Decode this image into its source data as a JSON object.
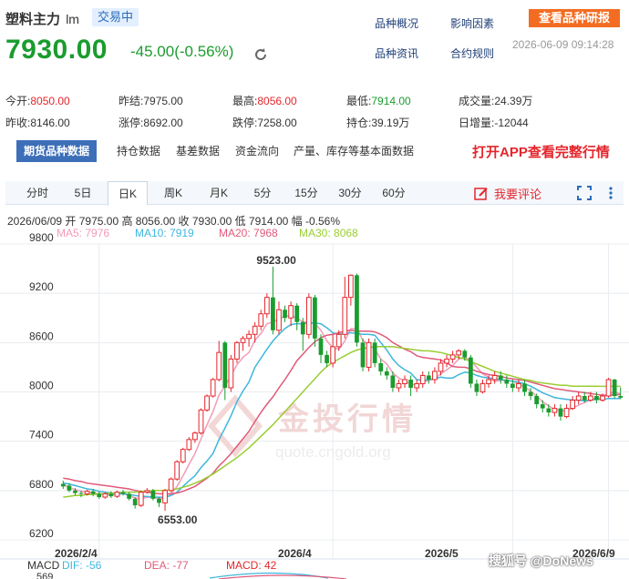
{
  "header": {
    "title": "塑料主力",
    "title_suffix": "lm",
    "badge": "交易中",
    "price": "7930.00",
    "change": "-45.00(-0.56%)",
    "datetime": "2026-06-09 09:14:28",
    "links": [
      "品种概况",
      "影响因素",
      "品种资讯",
      "合约规则"
    ],
    "research_button": "查看品种研报"
  },
  "stats": [
    {
      "label": "今开:",
      "value": "8050.00",
      "tone": "red"
    },
    {
      "label": "昨结:",
      "value": "7975.00",
      "tone": "plain"
    },
    {
      "label": "最高:",
      "value": "8056.00",
      "tone": "red"
    },
    {
      "label": "最低:",
      "value": "7914.00",
      "tone": "green"
    },
    {
      "label": "成交量:",
      "value": "24.39万",
      "tone": "plain"
    },
    {
      "label": "昨收:",
      "value": "8146.00",
      "tone": "plain"
    },
    {
      "label": "涨停:",
      "value": "8692.00",
      "tone": "plain"
    },
    {
      "label": "跌停:",
      "value": "7258.00",
      "tone": "plain"
    },
    {
      "label": "持仓:",
      "value": "39.19万",
      "tone": "plain"
    },
    {
      "label": "日增量:",
      "value": "-12044",
      "tone": "plain"
    }
  ],
  "data_tabs": [
    "期货品种数据",
    "持仓数据",
    "基差数据",
    "资金流向",
    "产量、库存等基本面数据"
  ],
  "app_promo": "打开APP查看完整行情",
  "period_tabs": [
    "分时",
    "5日",
    "日K",
    "周K",
    "月K",
    "5分",
    "15分",
    "30分",
    "60分"
  ],
  "active_period": "日K",
  "comment_button": "我要评论",
  "kline_info": {
    "date": "2026/06/09",
    "open": "开 7975.00",
    "high": "高 8056.00",
    "close": "收 7930.00",
    "low": "低 7914.00",
    "amp": "幅 -0.56%"
  },
  "ma_labels": [
    {
      "text": "MA5: 7976",
      "color": "#f39bb8"
    },
    {
      "text": "MA10: 7919",
      "color": "#3fb6dd"
    },
    {
      "text": "MA20: 7968",
      "color": "#e05a7a"
    },
    {
      "text": "MA30: 8068",
      "color": "#9acd32"
    }
  ],
  "macd": {
    "label": "MACD",
    "dif": "DIF: -56",
    "dea": "DEA: -77",
    "macd": "MACD: 42",
    "axis_top": "569"
  },
  "watermark": {
    "main": "金投行情",
    "sub": "quote.cngold.org"
  },
  "corner_watermark": "搜狐号 @DoNews",
  "colors": {
    "up": "#e4262c",
    "down": "#1a9c2e",
    "brand": "#3d6fb8"
  },
  "chart_data": {
    "type": "candlestick",
    "y_ticks": [
      9800,
      9200,
      8600,
      8000,
      7400,
      6800,
      6200
    ],
    "ylim": [
      6200,
      9800
    ],
    "x_ticks": [
      "2026/2/4",
      "2026/4",
      "2026/5",
      "2026/6/9"
    ],
    "annotations": [
      {
        "text": "9523.00",
        "value": 9523
      },
      {
        "text": "6553.00",
        "value": 6553
      }
    ],
    "candles": [
      [
        6880,
        6850,
        6920,
        6820
      ],
      [
        6860,
        6800,
        6890,
        6780
      ],
      [
        6800,
        6770,
        6830,
        6740
      ],
      [
        6770,
        6760,
        6800,
        6720
      ],
      [
        6760,
        6790,
        6810,
        6740
      ],
      [
        6790,
        6760,
        6820,
        6730
      ],
      [
        6760,
        6720,
        6790,
        6700
      ],
      [
        6720,
        6760,
        6780,
        6700
      ],
      [
        6760,
        6730,
        6790,
        6710
      ],
      [
        6730,
        6780,
        6800,
        6710
      ],
      [
        6780,
        6760,
        6810,
        6740
      ],
      [
        6760,
        6700,
        6780,
        6680
      ],
      [
        6700,
        6620,
        6720,
        6580
      ],
      [
        6620,
        6780,
        6800,
        6600
      ],
      [
        6780,
        6800,
        6830,
        6760
      ],
      [
        6800,
        6700,
        6820,
        6680
      ],
      [
        6700,
        6650,
        6720,
        6600
      ],
      [
        6650,
        6800,
        6820,
        6553
      ],
      [
        6800,
        6940,
        6960,
        6780
      ],
      [
        6940,
        7150,
        7170,
        6920
      ],
      [
        7150,
        7300,
        7320,
        7130
      ],
      [
        7300,
        7420,
        7450,
        7280
      ],
      [
        7420,
        7500,
        7520,
        7380
      ],
      [
        7500,
        7780,
        7800,
        7480
      ],
      [
        7780,
        7950,
        7970,
        7760
      ],
      [
        7950,
        8150,
        8170,
        7930
      ],
      [
        8150,
        8480,
        8620,
        8130
      ],
      [
        8600,
        8050,
        8620,
        7900
      ],
      [
        8050,
        8400,
        8450,
        8000
      ],
      [
        8400,
        8600,
        8620,
        8350
      ],
      [
        8600,
        8650,
        8680,
        8500
      ],
      [
        8650,
        8700,
        8750,
        8550
      ],
      [
        8700,
        8800,
        8850,
        8600
      ],
      [
        8800,
        8950,
        9000,
        8750
      ],
      [
        8950,
        9150,
        9200,
        8900
      ],
      [
        9150,
        8750,
        9523,
        8700
      ],
      [
        8750,
        9000,
        9100,
        8700
      ],
      [
        9000,
        8900,
        9050,
        8850
      ],
      [
        8900,
        9050,
        9100,
        8800
      ],
      [
        9050,
        8850,
        9080,
        8750
      ],
      [
        8850,
        8700,
        8900,
        8500
      ],
      [
        8700,
        9150,
        9200,
        8650
      ],
      [
        9150,
        8650,
        9180,
        8550
      ],
      [
        8650,
        8450,
        8700,
        8350
      ],
      [
        8450,
        8350,
        8500,
        8300
      ],
      [
        8350,
        8550,
        8700,
        8300
      ],
      [
        8550,
        8700,
        8750,
        8500
      ],
      [
        8700,
        9150,
        9400,
        8650
      ],
      [
        9150,
        9420,
        9430,
        9050
      ],
      [
        9420,
        8600,
        9440,
        8550
      ],
      [
        8600,
        8300,
        8650,
        8250
      ],
      [
        8300,
        8600,
        8650,
        8250
      ],
      [
        8600,
        8350,
        8650,
        8300
      ],
      [
        8350,
        8250,
        8400,
        8200
      ],
      [
        8250,
        8200,
        8300,
        8150
      ],
      [
        8200,
        8050,
        8250,
        8000
      ],
      [
        8050,
        8100,
        8150,
        8000
      ],
      [
        8100,
        8150,
        8200,
        8050
      ],
      [
        8150,
        8050,
        8200,
        7950
      ],
      [
        8050,
        8100,
        8150,
        8000
      ],
      [
        8100,
        8200,
        8250,
        8050
      ],
      [
        8200,
        8150,
        8250,
        8100
      ],
      [
        8150,
        8250,
        8300,
        8100
      ],
      [
        8250,
        8350,
        8400,
        8200
      ],
      [
        8350,
        8400,
        8450,
        8300
      ],
      [
        8400,
        8450,
        8500,
        8350
      ],
      [
        8450,
        8500,
        8520,
        8400
      ],
      [
        8500,
        8420,
        8520,
        8380
      ],
      [
        8420,
        8100,
        8450,
        8050
      ],
      [
        8100,
        8000,
        8150,
        7950
      ],
      [
        8000,
        8100,
        8150,
        7980
      ],
      [
        8100,
        8150,
        8200,
        8050
      ],
      [
        8150,
        8200,
        8250,
        8100
      ],
      [
        8200,
        8150,
        8250,
        8100
      ],
      [
        8150,
        8100,
        8200,
        8050
      ],
      [
        8100,
        8050,
        8150,
        8000
      ],
      [
        8050,
        8100,
        8150,
        8000
      ],
      [
        8100,
        8000,
        8150,
        7950
      ],
      [
        8000,
        7950,
        8050,
        7900
      ],
      [
        7950,
        7850,
        7980,
        7800
      ],
      [
        7850,
        7800,
        7900,
        7750
      ],
      [
        7800,
        7750,
        7850,
        7700
      ],
      [
        7750,
        7800,
        7850,
        7700
      ],
      [
        7800,
        7700,
        7850,
        7650
      ],
      [
        7700,
        7800,
        7850,
        7680
      ],
      [
        7800,
        7900,
        7950,
        7780
      ],
      [
        7900,
        7950,
        8000,
        7850
      ],
      [
        7950,
        7900,
        8000,
        7870
      ],
      [
        7900,
        7950,
        8000,
        7880
      ],
      [
        7950,
        7900,
        8000,
        7860
      ],
      [
        7900,
        7950,
        7980,
        7880
      ],
      [
        7950,
        8150,
        8170,
        7930
      ],
      [
        8150,
        7950,
        8160,
        7920
      ],
      [
        7950,
        7930,
        8056,
        7914
      ]
    ],
    "series": [
      {
        "name": "MA5",
        "color": "#f39bb8",
        "values": [
          6870,
          6840,
          6810,
          6790,
          6780,
          6770,
          6760,
          6750,
          6750,
          6750,
          6760,
          6740,
          6710,
          6700,
          6720,
          6720,
          6700,
          6710,
          6760,
          6850,
          6980,
          7120,
          7250,
          7430,
          7600,
          7760,
          7960,
          8070,
          8200,
          8330,
          8420,
          8480,
          8630,
          8710,
          8830,
          8850,
          8890,
          8920,
          8930,
          8900,
          8850,
          8850,
          8830,
          8750,
          8620,
          8540,
          8520,
          8620,
          8770,
          8770,
          8630,
          8570,
          8520,
          8400,
          8340,
          8230,
          8170,
          8130,
          8100,
          8080,
          8120,
          8140,
          8160,
          8220,
          8270,
          8320,
          8400,
          8420,
          8380,
          8300,
          8220,
          8180,
          8130,
          8140,
          8140,
          8130,
          8100,
          8060,
          8010,
          7950,
          7880,
          7830,
          7790,
          7770,
          7770,
          7800,
          7840,
          7870,
          7910,
          7920,
          7930,
          7980,
          8000,
          7976
        ]
      },
      {
        "name": "MA10",
        "color": "#3fb6dd",
        "values": [
          6890,
          6880,
          6860,
          6840,
          6820,
          6810,
          6790,
          6780,
          6770,
          6760,
          6760,
          6750,
          6740,
          6730,
          6730,
          6720,
          6720,
          6720,
          6740,
          6780,
          6850,
          6920,
          6980,
          7080,
          7160,
          7250,
          7420,
          7560,
          7710,
          7880,
          8010,
          8120,
          8300,
          8410,
          8520,
          8620,
          8700,
          8770,
          8820,
          8830,
          8830,
          8840,
          8840,
          8830,
          8780,
          8720,
          8700,
          8710,
          8720,
          8710,
          8700,
          8700,
          8690,
          8600,
          8510,
          8400,
          8320,
          8270,
          8230,
          8150,
          8140,
          8150,
          8160,
          8180,
          8170,
          8170,
          8210,
          8240,
          8230,
          8200,
          8180,
          8170,
          8160,
          8150,
          8140,
          8130,
          8120,
          8100,
          8070,
          8030,
          7990,
          7960,
          7930,
          7920,
          7910,
          7900,
          7900,
          7890,
          7900,
          7910,
          7910,
          7920,
          7920,
          7919
        ]
      },
      {
        "name": "MA20",
        "color": "#e05a7a",
        "values": [
          6950,
          6940,
          6920,
          6910,
          6890,
          6880,
          6870,
          6860,
          6850,
          6840,
          6830,
          6820,
          6800,
          6790,
          6780,
          6770,
          6760,
          6760,
          6760,
          6770,
          6790,
          6820,
          6850,
          6900,
          6950,
          7010,
          7100,
          7170,
          7250,
          7340,
          7430,
          7520,
          7640,
          7750,
          7850,
          7940,
          8050,
          8150,
          8260,
          8380,
          8460,
          8540,
          8610,
          8660,
          8690,
          8700,
          8720,
          8740,
          8750,
          8740,
          8740,
          8740,
          8730,
          8700,
          8660,
          8600,
          8560,
          8520,
          8490,
          8440,
          8420,
          8410,
          8400,
          8390,
          8350,
          8310,
          8300,
          8300,
          8280,
          8250,
          8230,
          8210,
          8200,
          8190,
          8170,
          8160,
          8150,
          8140,
          8120,
          8100,
          8080,
          8060,
          8040,
          8030,
          8020,
          8010,
          8000,
          7990,
          7980,
          7970,
          7960,
          7960,
          7965,
          7968
        ]
      },
      {
        "name": "MA30",
        "color": "#9acd32",
        "values": [
          6720,
          6730,
          6740,
          6740,
          6750,
          6750,
          6760,
          6760,
          6770,
          6770,
          6780,
          6780,
          6780,
          6790,
          6790,
          6800,
          6800,
          6800,
          6810,
          6820,
          6840,
          6860,
          6890,
          6920,
          6960,
          7000,
          7050,
          7100,
          7150,
          7200,
          7260,
          7320,
          7390,
          7460,
          7530,
          7600,
          7680,
          7760,
          7840,
          7920,
          8000,
          8080,
          8160,
          8240,
          8310,
          8360,
          8400,
          8440,
          8480,
          8510,
          8530,
          8540,
          8550,
          8550,
          8550,
          8550,
          8540,
          8530,
          8520,
          8510,
          8500,
          8500,
          8490,
          8480,
          8460,
          8440,
          8420,
          8400,
          8370,
          8340,
          8310,
          8280,
          8250,
          8230,
          8210,
          8190,
          8170,
          8150,
          8140,
          8120,
          8110,
          8100,
          8090,
          8080,
          8080,
          8070,
          8070,
          8070,
          8070,
          8070,
          8068,
          8068,
          8068,
          8068
        ]
      }
    ],
    "title": "",
    "xlabel": "",
    "ylabel": ""
  }
}
